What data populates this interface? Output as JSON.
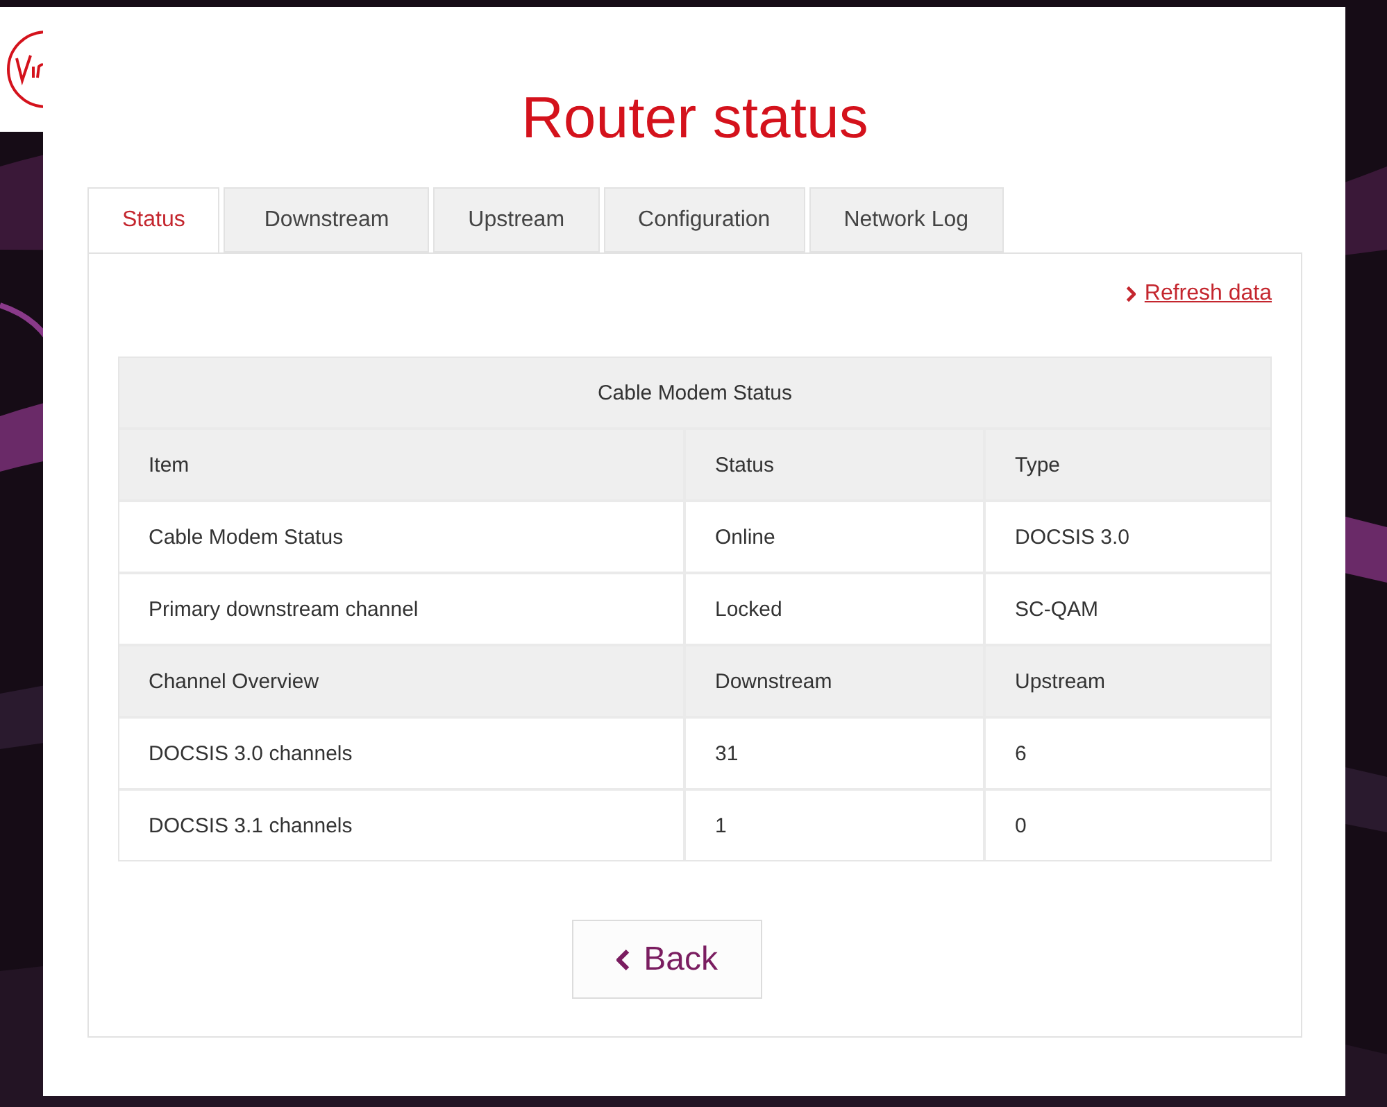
{
  "title": "Router status",
  "tabs": [
    {
      "label": "Status",
      "selected": true
    },
    {
      "label": "Downstream",
      "selected": false
    },
    {
      "label": "Upstream",
      "selected": false
    },
    {
      "label": "Configuration",
      "selected": false
    },
    {
      "label": "Network Log",
      "selected": false
    }
  ],
  "refresh_link": "Refresh data",
  "table": {
    "caption": "Cable Modem Status",
    "rows": [
      {
        "kind": "heading",
        "cells": [
          "Item",
          "Status",
          "Type"
        ]
      },
      {
        "kind": "data",
        "cells": [
          "Cable Modem Status",
          "Online",
          "DOCSIS 3.0"
        ]
      },
      {
        "kind": "data",
        "cells": [
          "Primary downstream channel",
          "Locked",
          "SC-QAM"
        ]
      },
      {
        "kind": "heading",
        "cells": [
          "Channel Overview",
          "Downstream",
          "Upstream"
        ]
      },
      {
        "kind": "data",
        "cells": [
          "DOCSIS 3.0 channels",
          "31",
          "6"
        ]
      },
      {
        "kind": "data",
        "cells": [
          "DOCSIS 3.1 channels",
          "1",
          "0"
        ]
      }
    ]
  },
  "back_button": "Back"
}
